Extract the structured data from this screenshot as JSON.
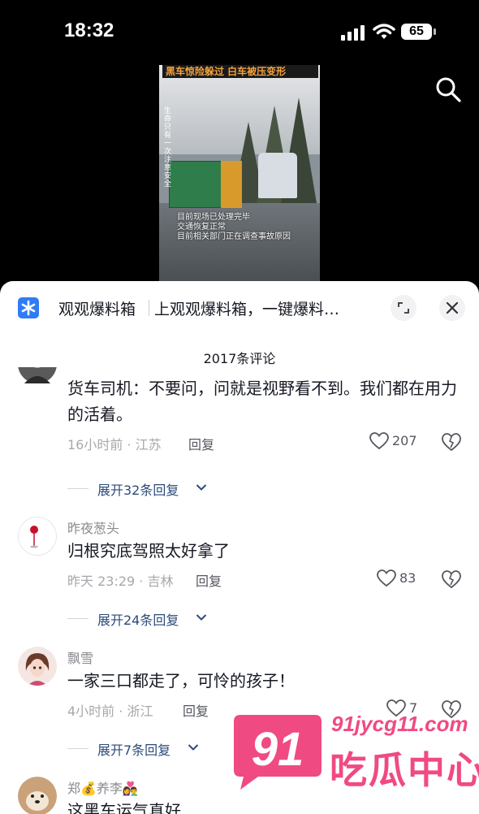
{
  "status_bar": {
    "time": "18:32",
    "battery": "65"
  },
  "video": {
    "banner": "黑车惊险躲过 白车被压变形",
    "vertical_text": "生命只有一次注意安全",
    "caption": [
      "目前现场已处理完毕",
      "交通恢复正常",
      "目前相关部门正在调查事故原因"
    ]
  },
  "ad": {
    "title": "观观爆料箱",
    "description": "上观观爆料箱，一键爆料…"
  },
  "comment_count": "2017条评论",
  "comments": [
    {
      "nickname": "",
      "text": "货车司机：不要问，问就是视野看不到。我们都在用力的活着。",
      "meta": "16小时前 · 江苏",
      "reply": "回复",
      "likes": "207",
      "expand": "展开32条回复"
    },
    {
      "nickname": "昨夜葱头",
      "text": "归根究底驾照太好拿了",
      "meta": "昨天 23:29 · 吉林",
      "reply": "回复",
      "likes": "83",
      "expand": "展开24条回复"
    },
    {
      "nickname": "飘雪",
      "text": "一家三口都走了，可怜的孩子！",
      "meta": "4小时前 · 浙江",
      "reply": "回复",
      "likes": "7",
      "expand": "展开7条回复"
    },
    {
      "nickname": "郑💰养李👩‍❤️‍👨",
      "text": "这黑车运气真好",
      "meta": "",
      "reply": "",
      "likes": "",
      "expand": ""
    }
  ],
  "watermark": {
    "number": "91",
    "url": "91jycg11.com",
    "name": "吃瓜中心"
  },
  "colors": {
    "accent": "#2f7cf6",
    "watermark": "#f04a83",
    "link": "#2c4b7a"
  }
}
